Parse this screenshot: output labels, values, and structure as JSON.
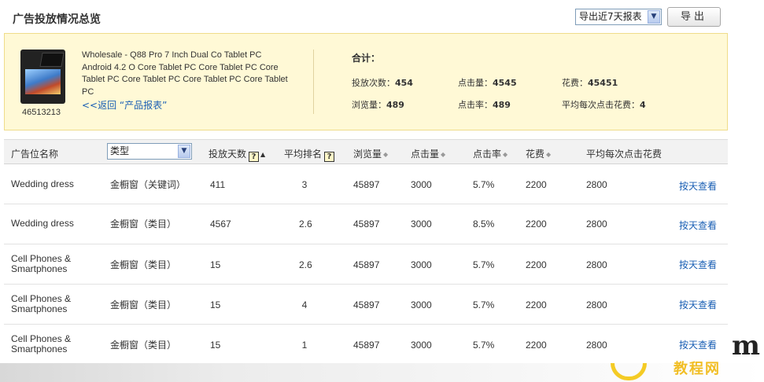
{
  "header": {
    "title": "广告投放情况总览",
    "export_select": "导出近7天报表",
    "export_button": "导出"
  },
  "summary": {
    "product_id": "46513213",
    "product_desc": "Wholesale - Q88 Pro 7 Inch Dual Co Tablet PC Android 4.2 O  Core Tablet PC  Core Tablet PC Core Tablet  PC  Core Tablet PC Core Tablet PC  Core Tablet PC",
    "back_link": "<<返回 “产品报表”",
    "total_label": "合计：",
    "stats": {
      "placements": {
        "label": "投放次数：",
        "value": "454"
      },
      "clicks": {
        "label": "点击量：",
        "value": "4545"
      },
      "spend": {
        "label": "花费：",
        "value": "45451"
      },
      "views": {
        "label": "浏览量：",
        "value": "489"
      },
      "ctr": {
        "label": "点击率：",
        "value": "489"
      },
      "avg_cost": {
        "label": "平均每次点击花费：",
        "value": "4"
      }
    }
  },
  "table": {
    "headers": {
      "name": "广告位名称",
      "type_select": "类型",
      "days": "投放天数",
      "rank": "平均排名",
      "views": "浏览量",
      "clicks": "点击量",
      "ctr": "点击率",
      "spend": "花费",
      "avg": "平均每次点击花费"
    },
    "rows": [
      {
        "name": "Wedding dress",
        "type": "金橱窗（关键词）",
        "days": "411",
        "rank": "3",
        "views": "45897",
        "clicks": "3000",
        "ctr": "5.7%",
        "spend": "2200",
        "avg": "2800",
        "action": "按天查看"
      },
      {
        "name": "Wedding dress",
        "type": "金橱窗（类目）",
        "days": "4567",
        "rank": "2.6",
        "views": "45897",
        "clicks": "3000",
        "ctr": "8.5%",
        "spend": "2200",
        "avg": "2800",
        "action": "按天查看"
      },
      {
        "name": "Cell Phones & Smartphones",
        "type": "金橱窗（类目）",
        "days": "15",
        "rank": "2.6",
        "views": "45897",
        "clicks": "3000",
        "ctr": "5.7%",
        "spend": "2200",
        "avg": "2800",
        "action": "按天查看"
      },
      {
        "name": "Cell Phones & Smartphones",
        "type": "金橱窗（类目）",
        "days": "15",
        "rank": "4",
        "views": "45897",
        "clicks": "3000",
        "ctr": "5.7%",
        "spend": "2200",
        "avg": "2800",
        "action": "按天查看"
      },
      {
        "name": "Cell Phones & Smartphones",
        "type": "金橱窗（类目）",
        "days": "15",
        "rank": "1",
        "views": "45897",
        "clicks": "3000",
        "ctr": "5.7%",
        "spend": "2200",
        "avg": "2800",
        "action": "按天查看"
      }
    ]
  },
  "watermark": {
    "text": "教程网",
    "letter": "m"
  }
}
